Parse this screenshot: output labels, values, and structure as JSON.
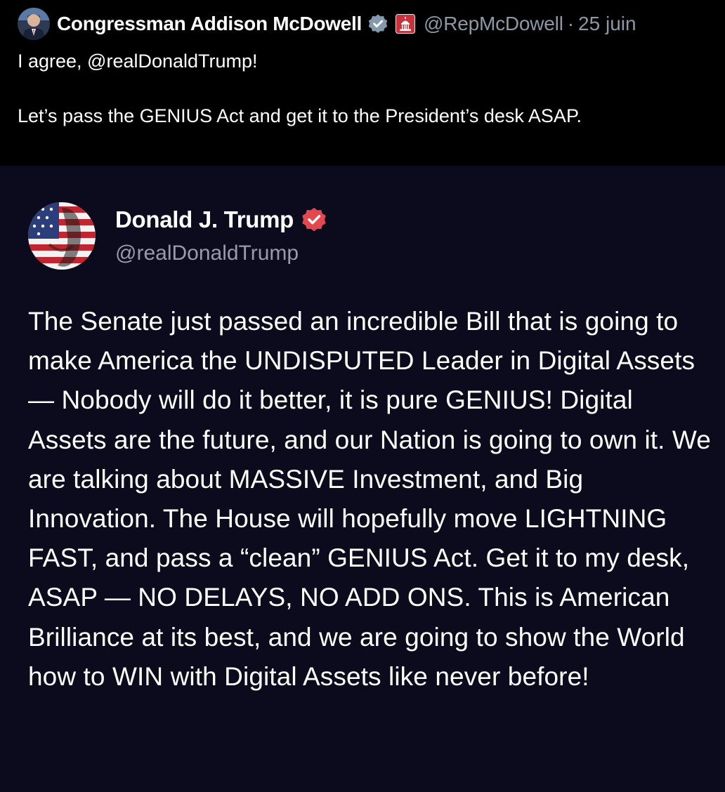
{
  "tweet": {
    "author_name": "Congressman Addison McDowell",
    "author_handle": "@RepMcDowell",
    "separator": "·",
    "date": "25 juin",
    "text_line1": "I agree, @realDonaldTrump!",
    "text_line2": "Let’s pass the GENIUS Act and get it to the President’s desk ASAP."
  },
  "quoted_post": {
    "author_name": "Donald J. Trump",
    "author_handle": "@realDonaldTrump",
    "body": "The Senate just passed an incredible Bill that is going to make America the UNDISPUTED Leader in Digital Assets — Nobody will do it better, it is pure GENIUS! Digital Assets are the future, and our Nation is going to own it. We are talking about MASSIVE Investment, and Big Innovation. The House will hopefully move LIGHTNING FAST, and pass a “clean” GENIUS Act. Get it to my desk, ASAP — NO DELAYS, NO ADD ONS. This is American Brilliance at its best, and we are going to show the World how to WIN with Digital Assets like never before!"
  },
  "icons": {
    "verified_gray": "verified-badge-icon",
    "affiliation": "capitol-badge-icon",
    "verified_red": "verified-badge-icon"
  },
  "colors": {
    "background": "#000000",
    "card_background": "#0c0b1e",
    "secondary_text": "#8b98a5",
    "verified_red": "#e2484f"
  }
}
